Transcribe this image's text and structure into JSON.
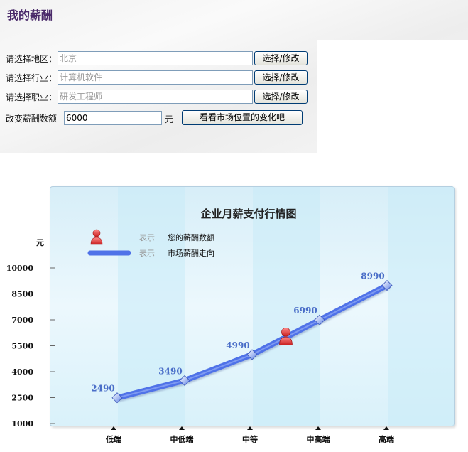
{
  "page": {
    "title": "我的薪酬"
  },
  "form": {
    "region": {
      "label": "请选择地区：",
      "value": "北京",
      "button": "选择/修改"
    },
    "industry": {
      "label": "请选择行业：",
      "value": "计算机软件",
      "button": "选择/修改"
    },
    "occupation": {
      "label": "请选择职业：",
      "value": "研发工程师",
      "button": "选择/修改"
    },
    "salary": {
      "label": "改变薪酬数额",
      "value": "6000",
      "unit": "元",
      "button": "看看市场位置的变化吧"
    }
  },
  "chart_data": {
    "type": "line",
    "title": "企业月薪支付行情图",
    "ylabel": "元",
    "categories": [
      "低端",
      "中低端",
      "中等",
      "中高端",
      "高端"
    ],
    "values": [
      2490,
      3490,
      4990,
      6990,
      8990
    ],
    "yticks": [
      1000,
      2500,
      4000,
      5500,
      7000,
      8500,
      10000
    ],
    "ylim": [
      1000,
      10000
    ],
    "user_marker": {
      "value": 6000,
      "position": 2.5
    },
    "legend": [
      {
        "icon": "person-icon",
        "prefix": "表示",
        "text": "您的薪酬数额"
      },
      {
        "icon": "line-swatch",
        "prefix": "表示",
        "text": "市场薪酬走向"
      }
    ],
    "colors": {
      "line": "#4f72e8",
      "marker": "#e03838",
      "label": "#4a6ec8"
    }
  }
}
